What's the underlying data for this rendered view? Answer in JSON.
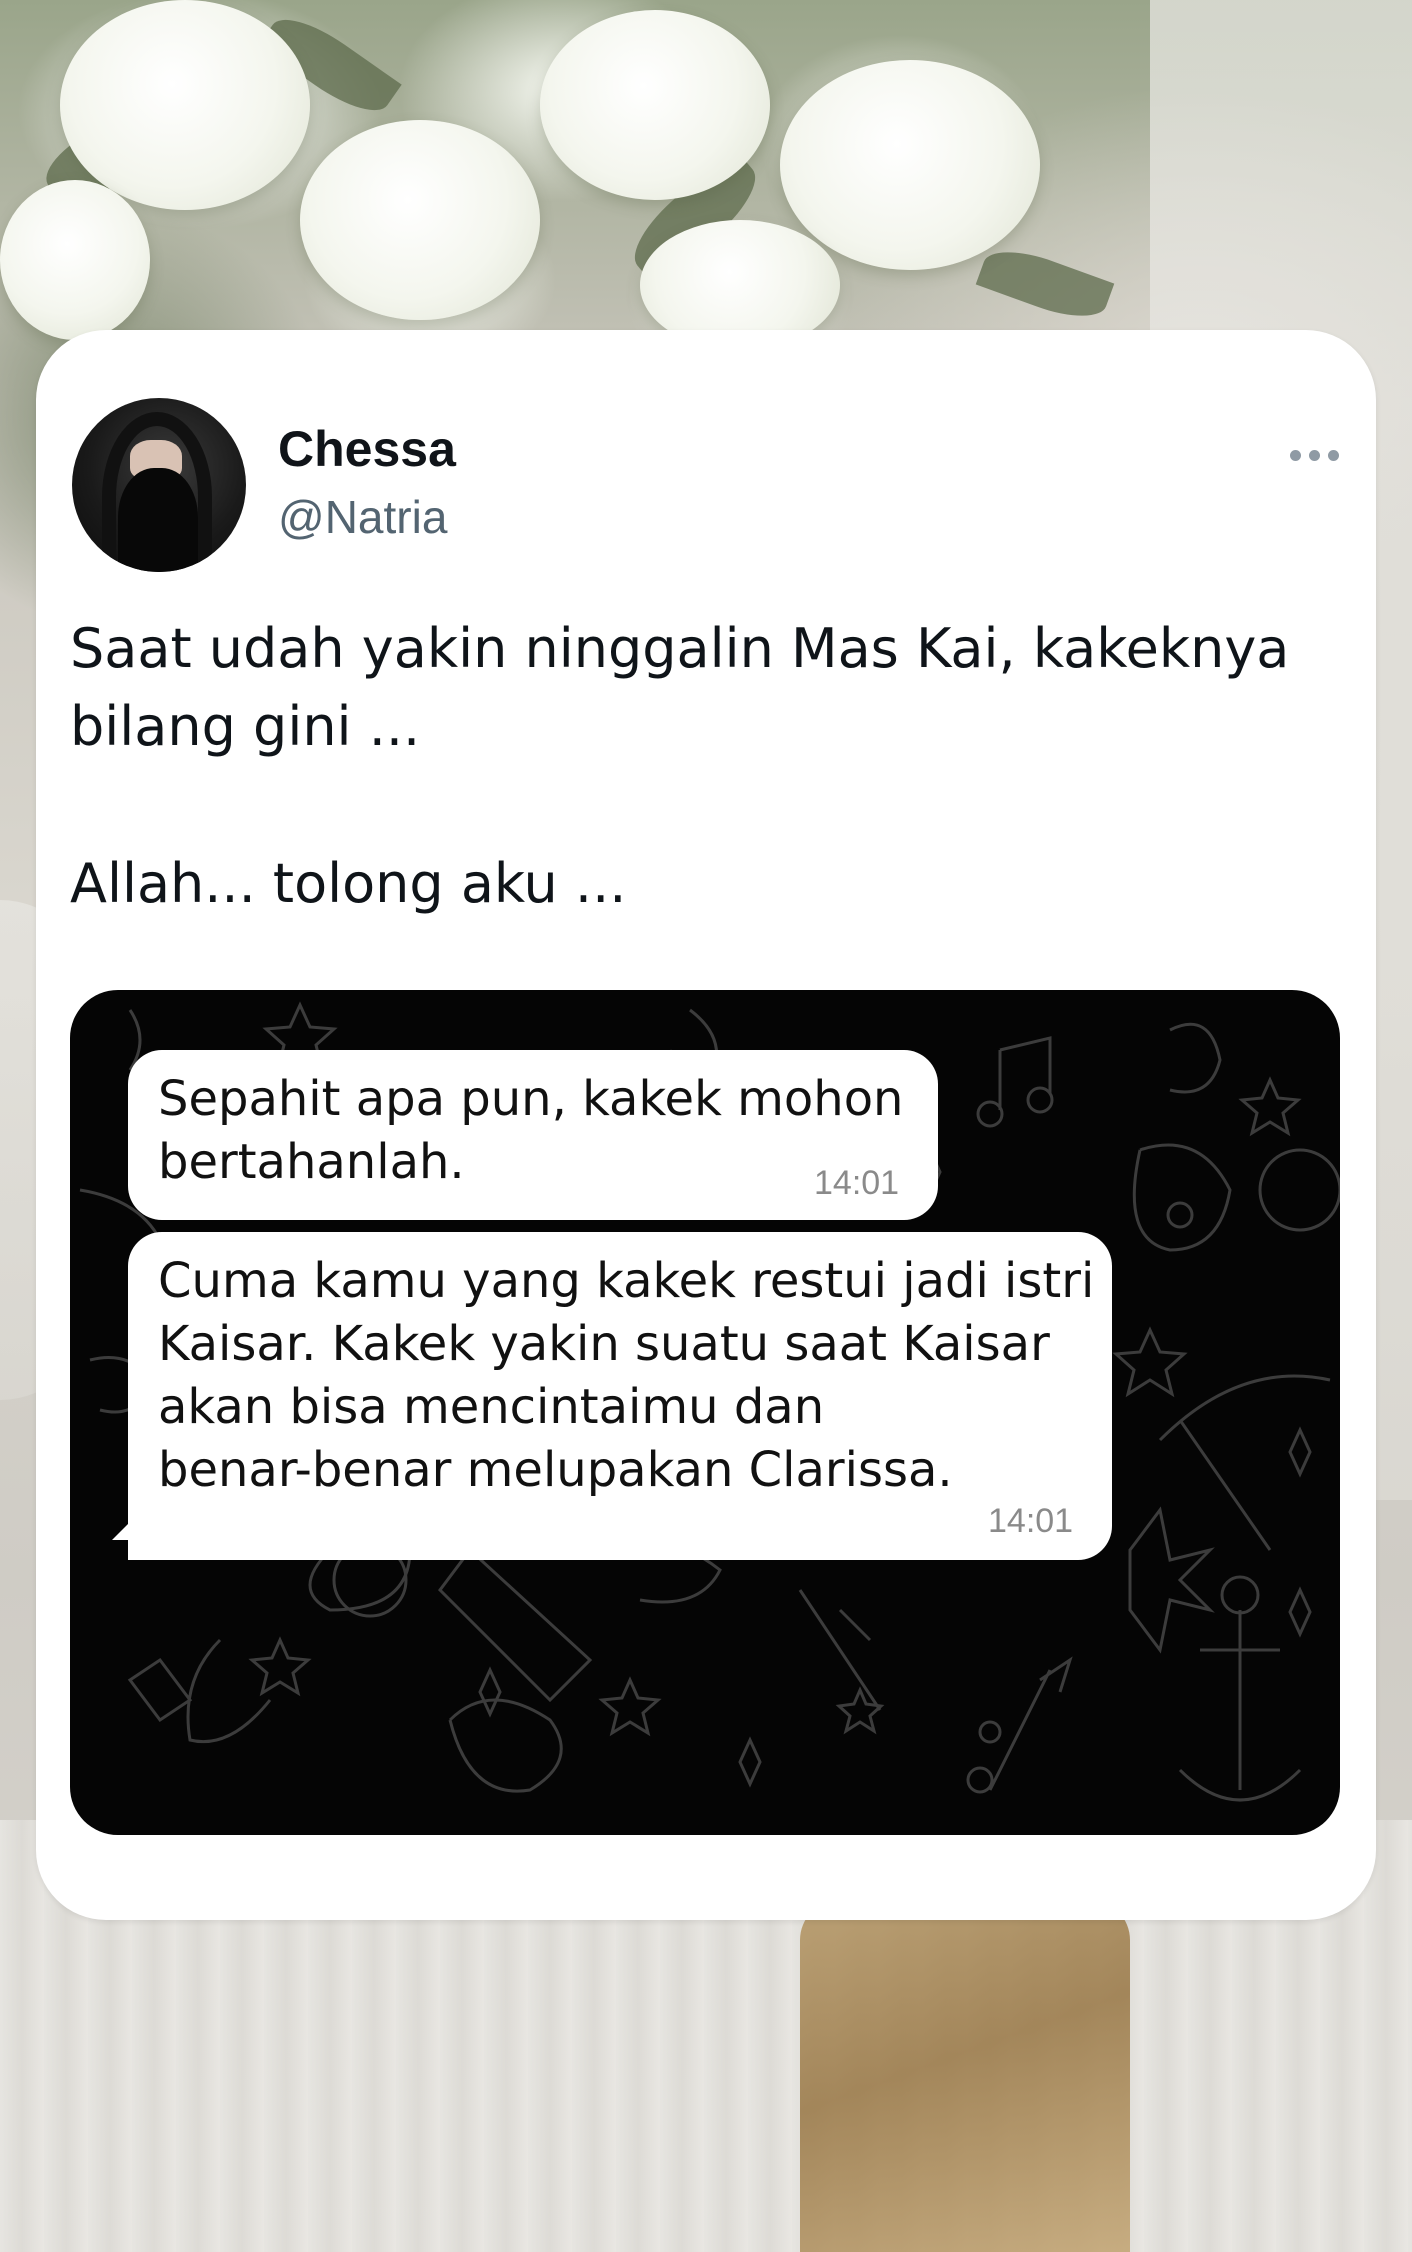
{
  "tweet": {
    "display_name": "Chessa",
    "handle": "@Natria",
    "text_lines": [
      "Saat udah yakin ninggalin Mas Kai, kakeknya",
      "bilang gini ...",
      "Allah... tolong aku ..."
    ]
  },
  "chat": {
    "messages": [
      {
        "lines": [
          "Sepahit apa pun, kakek mohon",
          "bertahanlah."
        ],
        "time": "14:01"
      },
      {
        "lines": [
          "Cuma kamu yang kakek restui jadi istri",
          "Kaisar. Kakek yakin suatu saat Kaisar",
          "akan bisa mencintaimu dan",
          "benar-benar melupakan Clarissa."
        ],
        "time": "14:01"
      }
    ]
  },
  "colors": {
    "card_background": "#ffffff",
    "name_text": "#101419",
    "handle_text": "#536471",
    "chat_background": "#050505",
    "bubble_background": "#ffffff",
    "timestamp_text": "#8a8a8a"
  },
  "icons": {
    "menu": "more-horizontal-icon"
  }
}
